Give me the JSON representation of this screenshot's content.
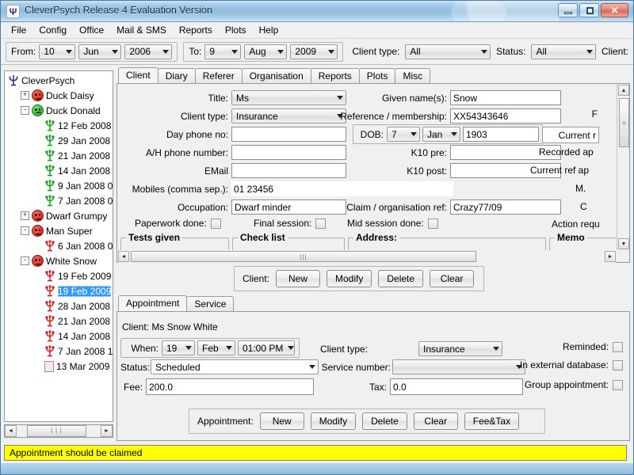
{
  "window": {
    "title": "CleverPsych Release 4 Evaluation Version",
    "app_icon": "psi-icon",
    "minimize_label": "",
    "maximize_label": "",
    "close_label": "✕"
  },
  "menubar": {
    "items": [
      {
        "label": "File"
      },
      {
        "label": "Config"
      },
      {
        "label": "Office"
      },
      {
        "label": "Mail & SMS"
      },
      {
        "label": "Reports"
      },
      {
        "label": "Plots"
      },
      {
        "label": "Help"
      }
    ]
  },
  "toolbar": {
    "from_label": "From:",
    "from_day": "10",
    "from_month": "Jun",
    "from_year": "2006",
    "to_label": "To:",
    "to_day": "9",
    "to_month": "Aug",
    "to_year": "2009",
    "client_type_label": "Client type:",
    "client_type_value": "All",
    "status_label": "Status:",
    "status_value": "All",
    "client_label": "Client:"
  },
  "tree": {
    "nodes": [
      {
        "label": "CleverPsych",
        "depth": 0,
        "expander": "",
        "icon": "psi-icon",
        "selected": false
      },
      {
        "label": "Duck Daisy",
        "depth": 1,
        "expander": "+",
        "icon": "face-sad-red",
        "selected": false
      },
      {
        "label": "Duck Donald",
        "depth": 1,
        "expander": "-",
        "icon": "face-happy-green",
        "selected": false
      },
      {
        "label": "12 Feb 2008",
        "depth": 2,
        "expander": "",
        "icon": "psi-green-icon",
        "selected": false
      },
      {
        "label": "29 Jan 2008",
        "depth": 2,
        "expander": "",
        "icon": "psi-green-icon",
        "selected": false
      },
      {
        "label": "21 Jan 2008",
        "depth": 2,
        "expander": "",
        "icon": "psi-green-icon",
        "selected": false
      },
      {
        "label": "14 Jan 2008",
        "depth": 2,
        "expander": "",
        "icon": "psi-green-icon",
        "selected": false
      },
      {
        "label": "9 Jan 2008 0",
        "depth": 2,
        "expander": "",
        "icon": "psi-green-icon",
        "selected": false
      },
      {
        "label": "7 Jan 2008 0",
        "depth": 2,
        "expander": "",
        "icon": "psi-green-icon",
        "selected": false
      },
      {
        "label": "Dwarf Grumpy",
        "depth": 1,
        "expander": "+",
        "icon": "face-sad-red",
        "selected": false
      },
      {
        "label": "Man Super",
        "depth": 1,
        "expander": "-",
        "icon": "face-sad-red",
        "selected": false
      },
      {
        "label": "6 Jan 2008 0",
        "depth": 2,
        "expander": "",
        "icon": "psi-red-icon",
        "selected": false
      },
      {
        "label": "White Snow",
        "depth": 1,
        "expander": "-",
        "icon": "face-sad-red",
        "selected": false
      },
      {
        "label": "19 Feb 2009",
        "depth": 2,
        "expander": "",
        "icon": "psi-red-icon",
        "selected": false
      },
      {
        "label": "19 Feb 2009",
        "depth": 2,
        "expander": "",
        "icon": "psi-red-icon",
        "selected": true
      },
      {
        "label": "28 Jan 2008",
        "depth": 2,
        "expander": "",
        "icon": "psi-red-icon",
        "selected": false
      },
      {
        "label": "21 Jan 2008",
        "depth": 2,
        "expander": "",
        "icon": "psi-red-icon",
        "selected": false
      },
      {
        "label": "14 Jan 2008",
        "depth": 2,
        "expander": "",
        "icon": "psi-red-icon",
        "selected": false
      },
      {
        "label": "7 Jan 2008 1",
        "depth": 2,
        "expander": "",
        "icon": "psi-red-icon",
        "selected": false
      },
      {
        "label": "13 Mar 2009",
        "depth": 2,
        "expander": "",
        "icon": "page-icon",
        "selected": false
      }
    ],
    "hscroll_left": "◄",
    "hscroll_right": "►",
    "hscroll_grip": "|||"
  },
  "client_tabs": {
    "items": [
      {
        "label": "Client",
        "active": true
      },
      {
        "label": "Diary",
        "active": false
      },
      {
        "label": "Referer",
        "active": false
      },
      {
        "label": "Organisation",
        "active": false
      },
      {
        "label": "Reports",
        "active": false
      },
      {
        "label": "Plots",
        "active": false
      },
      {
        "label": "Misc",
        "active": false
      }
    ]
  },
  "client_form": {
    "title_label": "Title:",
    "title_value": "Ms",
    "given_names_label": "Given name(s):",
    "given_names_value": "Snow",
    "client_type_label": "Client type:",
    "client_type_value": "Insurance",
    "reference_label": "Reference / membership:",
    "reference_value": "XX54343646",
    "day_phone_label": "Day phone no:",
    "day_phone_value": "",
    "dob_label": "DOB:",
    "dob_day": "7",
    "dob_month": "Jan",
    "dob_year": "1903",
    "ah_phone_label": "A/H phone number:",
    "ah_phone_value": "",
    "k10_pre_label": "K10 pre:",
    "k10_pre_value": "",
    "email_label": "EMail",
    "email_value": "",
    "k10_post_label": "K10 post:",
    "k10_post_value": "",
    "mobiles_label": "Mobiles (comma sep.):",
    "mobiles_value": "01 23456",
    "occupation_label": "Occupation:",
    "occupation_value": "Dwarf minder",
    "claim_ref_label": "Claim / organisation ref:",
    "claim_ref_value": "Crazy77/09",
    "paperwork_label": "Paperwork done:",
    "final_session_label": "Final session:",
    "mid_session_label": "Mid session done:",
    "tests_given_caption": "Tests given",
    "check_list_caption": "Check list",
    "address_caption": "Address:",
    "memo_caption": "Memo",
    "clipped_right": [
      {
        "text": "F"
      },
      {
        "text": "Current r"
      },
      {
        "text": "Recorded ap"
      },
      {
        "text": "Current ref ap"
      },
      {
        "text": "M."
      },
      {
        "text": "C"
      },
      {
        "text": "Action requ"
      }
    ]
  },
  "client_buttons": {
    "group_label": "Client:",
    "buttons": [
      {
        "label": "New"
      },
      {
        "label": "Modify"
      },
      {
        "label": "Delete"
      },
      {
        "label": "Clear"
      }
    ]
  },
  "appointment_tabs": {
    "items": [
      {
        "label": "Appointment",
        "active": true
      },
      {
        "label": "Service",
        "active": false
      }
    ]
  },
  "appointment_form": {
    "client_line": "Client: Ms Snow White",
    "when_label": "When:",
    "when_day": "19",
    "when_month": "Feb",
    "when_time": "01:00 PM",
    "client_type_label": "Client type:",
    "client_type_value": "Insurance",
    "reminded_label": "Reminded:",
    "status_label": "Status:",
    "status_value": "Scheduled",
    "service_number_label": "Service number:",
    "service_number_value": "",
    "in_external_db_label": "In external database:",
    "fee_label": "Fee:",
    "fee_value": "200.0",
    "tax_label": "Tax:",
    "tax_value": "0.0",
    "group_appointment_label": "Group appointment:"
  },
  "appointment_buttons": {
    "group_label": "Appointment:",
    "buttons": [
      {
        "label": "New"
      },
      {
        "label": "Modify"
      },
      {
        "label": "Delete"
      },
      {
        "label": "Clear"
      },
      {
        "label": "Fee&Tax"
      }
    ]
  },
  "statusbar": {
    "message": "Appointment should be claimed",
    "message_bg": "#ffff00"
  }
}
